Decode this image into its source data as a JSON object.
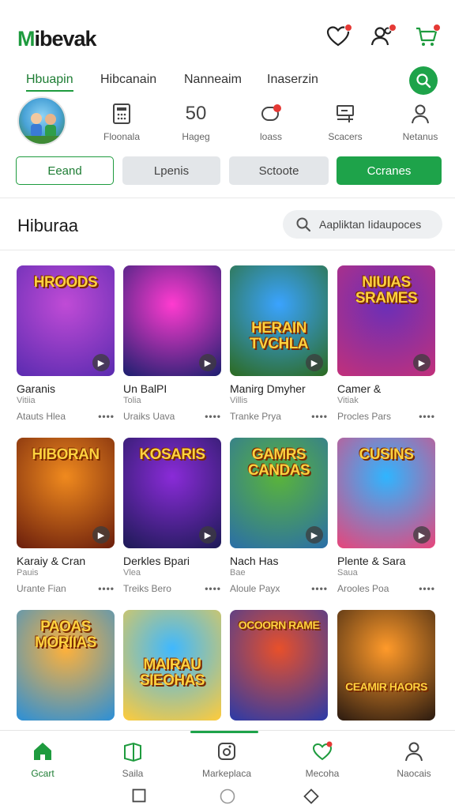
{
  "app": {
    "logo_m": "M",
    "logo_rest": "ibevak"
  },
  "tabs": [
    {
      "label": "Hbuapin",
      "active": true
    },
    {
      "label": "Hibcanain",
      "active": false
    },
    {
      "label": "Nanneaim",
      "active": false
    },
    {
      "label": "Inaserzin",
      "active": false
    }
  ],
  "profile": {
    "stats": [
      {
        "icon": "calculator-icon",
        "value": "",
        "label": "Floonala"
      },
      {
        "icon": "",
        "value": "50",
        "label": "Hageg"
      },
      {
        "icon": "chat-bubble-icon",
        "value": "",
        "label": "loass"
      },
      {
        "icon": "desk-icon",
        "value": "",
        "label": "Scacers"
      },
      {
        "icon": "person-icon",
        "value": "",
        "label": "Netanus"
      }
    ]
  },
  "chips": [
    {
      "label": "Eeand",
      "style": "outline"
    },
    {
      "label": "Lpenis",
      "style": "grey"
    },
    {
      "label": "Sctoote",
      "style": "grey"
    },
    {
      "label": "Ccranes",
      "style": "green"
    }
  ],
  "section": {
    "title": "Hiburaa",
    "search_placeholder": "Aapliktan Iidaupoces"
  },
  "games": [
    {
      "title_art": "HROODS",
      "name": "Garanis",
      "sub": "Vitiia",
      "meta": "Atauts Hlea",
      "colors": [
        "#c04bd6",
        "#5a2bb0"
      ]
    },
    {
      "title_art": "",
      "name": "Un BalPI",
      "sub": "Tolia",
      "meta": "Uraiks Uava",
      "colors": [
        "#ff3bd0",
        "#1b1f6e"
      ]
    },
    {
      "title_art": "HERAIN TVCHLA",
      "name": "Manirg Dmyher",
      "sub": "Villis",
      "meta": "Tranke Prya",
      "colors": [
        "#3aa3ff",
        "#2c6a1f"
      ]
    },
    {
      "title_art": "NIUIAS SRAMES",
      "name": "Camer &",
      "sub": "Vitiak",
      "meta": "Procles Pars",
      "colors": [
        "#6a2fb8",
        "#c2307a"
      ]
    },
    {
      "title_art": "HIBORAN",
      "name": "Karaiy & Cran",
      "sub": "Pauis",
      "meta": "Urante Fian",
      "colors": [
        "#f08a1e",
        "#6a1d0c"
      ]
    },
    {
      "title_art": "KOSARIS",
      "name": "Derkles Bpari",
      "sub": "Vlea",
      "meta": "Treiks Bero",
      "colors": [
        "#8a2bd8",
        "#1c1a55"
      ]
    },
    {
      "title_art": "GAMRS CANDAS",
      "name": "Nach Has",
      "sub": "Bae",
      "meta": "Aloule Payx",
      "colors": [
        "#5ab43a",
        "#2a6ea8"
      ]
    },
    {
      "title_art": "CUSINS",
      "name": "Plente & Sara",
      "sub": "Saua",
      "meta": "Arooles Poa",
      "colors": [
        "#2fb5ff",
        "#e8457a"
      ]
    },
    {
      "title_art": "PAOAS MORIIAS",
      "name": "",
      "sub": "",
      "meta": "",
      "colors": [
        "#ffb13a",
        "#2a8fd8"
      ]
    },
    {
      "title_art": "MAIRAU SIEOHAS",
      "name": "",
      "sub": "",
      "meta": "",
      "colors": [
        "#3fb8ff",
        "#ffcb3a"
      ]
    },
    {
      "title_art": "OCOORN RAME",
      "name": "",
      "sub": "",
      "meta": "",
      "colors": [
        "#e8502a",
        "#2a3aa8"
      ]
    },
    {
      "title_art": "CEAMIR HAORS",
      "name": "",
      "sub": "",
      "meta": "",
      "colors": [
        "#ff9a2a",
        "#2a1a10"
      ]
    }
  ],
  "bottom_nav": [
    {
      "label": "Gcart",
      "icon": "home-icon",
      "active": true
    },
    {
      "label": "Saila",
      "icon": "bag-icon",
      "active": false
    },
    {
      "label": "Markeplaca",
      "icon": "marketplace-icon",
      "active": false
    },
    {
      "label": "Mecoha",
      "icon": "heart-icon",
      "active": false
    },
    {
      "label": "Naocais",
      "icon": "person-icon",
      "active": false
    }
  ],
  "colors": {
    "accent": "#1ea34a",
    "notification": "#e53935"
  }
}
